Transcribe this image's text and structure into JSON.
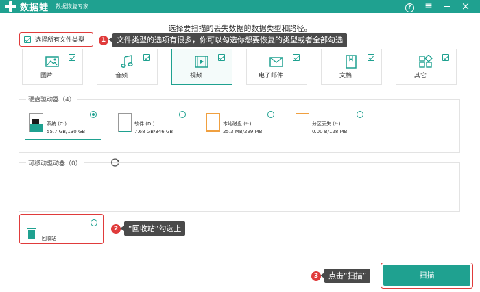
{
  "app": {
    "name": "数据蛙",
    "subtitle": "数据恢复专家"
  },
  "window_controls": {
    "help": "?",
    "menu": "≡",
    "close": "×"
  },
  "prompt": "选择要扫描的丢失数据的数据类型和路径。",
  "select_all": {
    "label": "选择所有文件类型",
    "checked": true
  },
  "callouts": [
    {
      "number": "1",
      "text": "文件类型的选项有很多，你可以勾选你想要恢复的类型或者全部勾选"
    },
    {
      "number": "2",
      "text": "“回收站”勾选上"
    },
    {
      "number": "3",
      "text": "点击“扫描”"
    }
  ],
  "file_types": [
    {
      "label": "图片",
      "icon": "image-icon",
      "checked": true
    },
    {
      "label": "音频",
      "icon": "music-note-icon",
      "checked": true
    },
    {
      "label": "视频",
      "icon": "video-icon",
      "checked": true,
      "active": true
    },
    {
      "label": "电子邮件",
      "icon": "email-icon",
      "checked": true
    },
    {
      "label": "文档",
      "icon": "document-icon",
      "checked": true
    },
    {
      "label": "其它",
      "icon": "other-icon",
      "checked": true
    }
  ],
  "hard_drives": {
    "title": "硬盘驱动器（4）",
    "drives": [
      {
        "name": "系统 (C:)",
        "size": "55.7 GB/130 GB",
        "selected": true,
        "used_fraction": 0.43
      },
      {
        "name": "软件 (D:)",
        "size": "7.68 GB/346 GB",
        "selected": false,
        "used_fraction": 0.02
      },
      {
        "name": "本地磁盘 (*:)",
        "size": "25.3 MB/299 MB",
        "selected": false,
        "used_fraction": 0.08
      },
      {
        "name": "分区丢失 (*:)",
        "size": "0.00 B/128 MB",
        "selected": false,
        "used_fraction": 0.0
      }
    ]
  },
  "removable": {
    "title": "可移动驱动器（0）"
  },
  "recycle_bin": {
    "label": "回收站",
    "checked": false
  },
  "scan_button": "扫描",
  "colors": {
    "accent": "#1fa190",
    "highlight": "#e03b3b",
    "callout_bg": "#4a4a4a",
    "drive_orange": "#f0a040"
  }
}
